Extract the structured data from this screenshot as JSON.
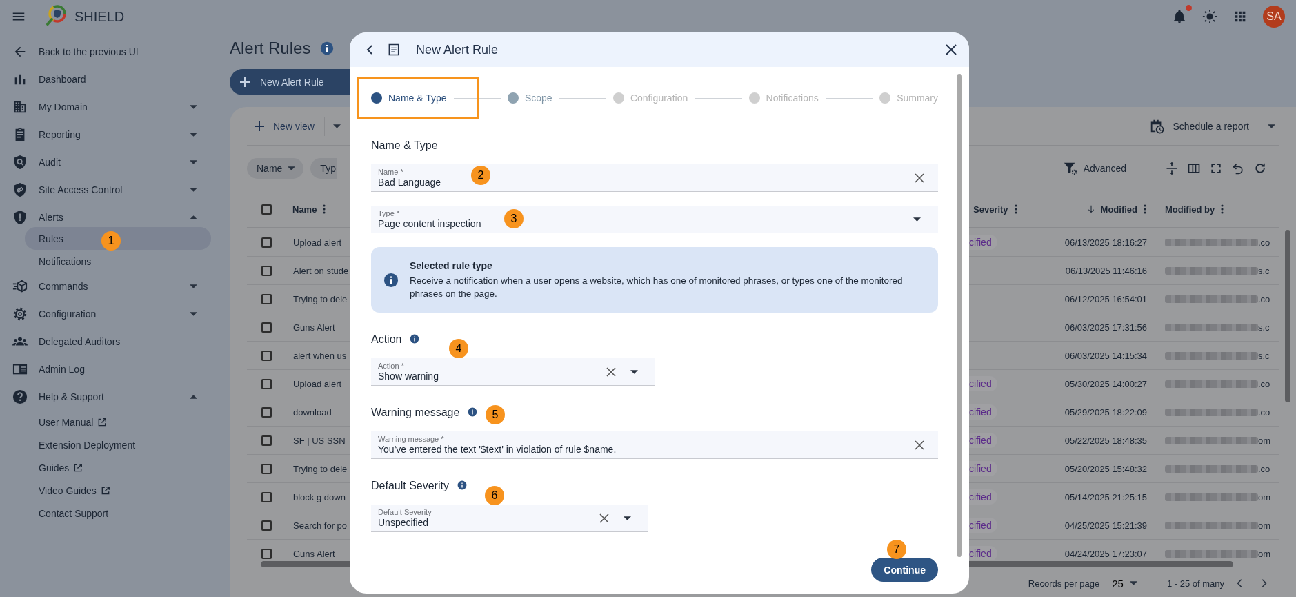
{
  "header": {
    "app_name": "SHIELD",
    "avatar": "SA"
  },
  "sidebar": {
    "back": "Back to the previous UI",
    "items": [
      {
        "label": "Dashboard"
      },
      {
        "label": "My Domain",
        "expanded": false
      },
      {
        "label": "Reporting",
        "expanded": false
      },
      {
        "label": "Audit",
        "expanded": false
      },
      {
        "label": "Site Access Control",
        "expanded": false
      },
      {
        "label": "Alerts",
        "expanded": true,
        "children": [
          {
            "label": "Rules",
            "selected": true,
            "external": false
          },
          {
            "label": "Notifications",
            "selected": false,
            "external": false
          }
        ]
      },
      {
        "label": "Commands",
        "expanded": false
      },
      {
        "label": "Configuration",
        "expanded": false
      },
      {
        "label": "Delegated Auditors"
      },
      {
        "label": "Admin Log"
      },
      {
        "label": "Help & Support",
        "expanded": true,
        "children": [
          {
            "label": "User Manual",
            "selected": false,
            "external": true
          },
          {
            "label": "Extension Deployment",
            "selected": false,
            "external": false
          },
          {
            "label": "Guides",
            "selected": false,
            "external": true
          },
          {
            "label": "Video Guides",
            "selected": false,
            "external": true
          },
          {
            "label": "Contact Support",
            "selected": false,
            "external": false
          }
        ]
      }
    ]
  },
  "page": {
    "title": "Alert Rules",
    "new_button": "New Alert Rule"
  },
  "toolbar": {
    "new_view": "New view",
    "schedule": "Schedule a report",
    "advanced": "Advanced"
  },
  "filters": [
    {
      "label": "Name",
      "has_menu": true
    },
    {
      "label": "Typ",
      "has_menu": false
    }
  ],
  "table": {
    "select_all_checked": false,
    "columns": [
      {
        "label": "Name",
        "sorted": false
      },
      {
        "label": "Severity",
        "sorted": false
      },
      {
        "label": "Modified",
        "sorted": true
      },
      {
        "label": "Modified by",
        "sorted": false
      }
    ],
    "rows": [
      {
        "checked": false,
        "name": "Upload alert",
        "severity": "cified",
        "modified": "06/13/2025 18:16:27",
        "modified_by": ".co"
      },
      {
        "checked": false,
        "name": "Alert on stude",
        "modified": "06/13/2025 11:46:16",
        "modified_by": "s.c"
      },
      {
        "checked": false,
        "name": "Trying to dele",
        "modified": "06/12/2025 16:54:01",
        "modified_by": ".co"
      },
      {
        "checked": false,
        "name": "Guns Alert",
        "modified": "06/03/2025 17:31:56",
        "modified_by": "s.c"
      },
      {
        "checked": false,
        "name": "alert when us",
        "modified": "06/03/2025 14:15:34",
        "modified_by": "s.c"
      },
      {
        "checked": false,
        "name": "Upload alert",
        "severity": "cified",
        "modified": "05/30/2025 14:00:27",
        "modified_by": ".co"
      },
      {
        "checked": false,
        "name": "download",
        "severity": "cified",
        "modified": "05/29/2025 18:22:09",
        "modified_by": ".co"
      },
      {
        "checked": false,
        "name": "SF | US SSN",
        "severity": "cified",
        "modified": "05/22/2025 18:48:35",
        "modified_by": "om"
      },
      {
        "checked": false,
        "name": "Trying to dele",
        "severity": "cified",
        "modified": "05/20/2025 15:48:32",
        "modified_by": ".co"
      },
      {
        "checked": false,
        "name": "block g down",
        "severity": "cified",
        "modified": "05/14/2025 21:25:15",
        "modified_by": "om"
      },
      {
        "checked": false,
        "name": "Search for po",
        "severity": "cified",
        "modified": "04/25/2025 15:21:39",
        "modified_by": "om"
      },
      {
        "checked": false,
        "name": "Guns Alert",
        "severity": "cified",
        "modified": "04/24/2025 17:23:07",
        "modified_by": "om"
      }
    ]
  },
  "pagination": {
    "label": "Records per page",
    "per_page": "25",
    "range": "1 - 25 of many"
  },
  "dialog": {
    "title": "New Alert Rule",
    "steps": [
      {
        "label": "Name & Type",
        "selected": true,
        "disabled": false
      },
      {
        "label": "Scope",
        "selected": false,
        "disabled": false
      },
      {
        "label": "Configuration",
        "selected": false,
        "disabled": true
      },
      {
        "label": "Notifications",
        "selected": false,
        "disabled": true
      },
      {
        "label": "Summary",
        "selected": false,
        "disabled": true
      }
    ],
    "sections": [
      {
        "heading": "Name & Type",
        "has_help": false,
        "fields": [
          {
            "kind": "text",
            "label": "Name *",
            "value": "Bad Language",
            "clearable": true
          },
          {
            "kind": "select",
            "label": "Type *",
            "value": "Page content inspection",
            "clearable": false
          }
        ],
        "note": {
          "title": "Selected rule type",
          "text": "Receive a notification when a user opens a website, which has one of monitored phrases, or types one of the monitored phrases on the page."
        }
      },
      {
        "heading": "Action",
        "has_help": true,
        "fields": [
          {
            "kind": "select",
            "label": "Action *",
            "value": "Show warning",
            "clearable": true
          }
        ]
      },
      {
        "heading": "Warning message",
        "has_help": true,
        "fields": [
          {
            "kind": "text",
            "label": "Warning message *",
            "value": "You've entered the text '$text' in violation of rule $name.",
            "clearable": true
          }
        ]
      },
      {
        "heading": "Default Severity",
        "has_help": true,
        "fields": [
          {
            "kind": "select",
            "label": "Default Severity",
            "value": "Unspecified",
            "clearable": true
          }
        ]
      }
    ],
    "continue": "Continue"
  },
  "annotations": [
    {
      "number": "1"
    },
    {
      "number": "2"
    },
    {
      "number": "3"
    },
    {
      "number": "4"
    },
    {
      "number": "5"
    },
    {
      "number": "6"
    },
    {
      "number": "7"
    }
  ]
}
